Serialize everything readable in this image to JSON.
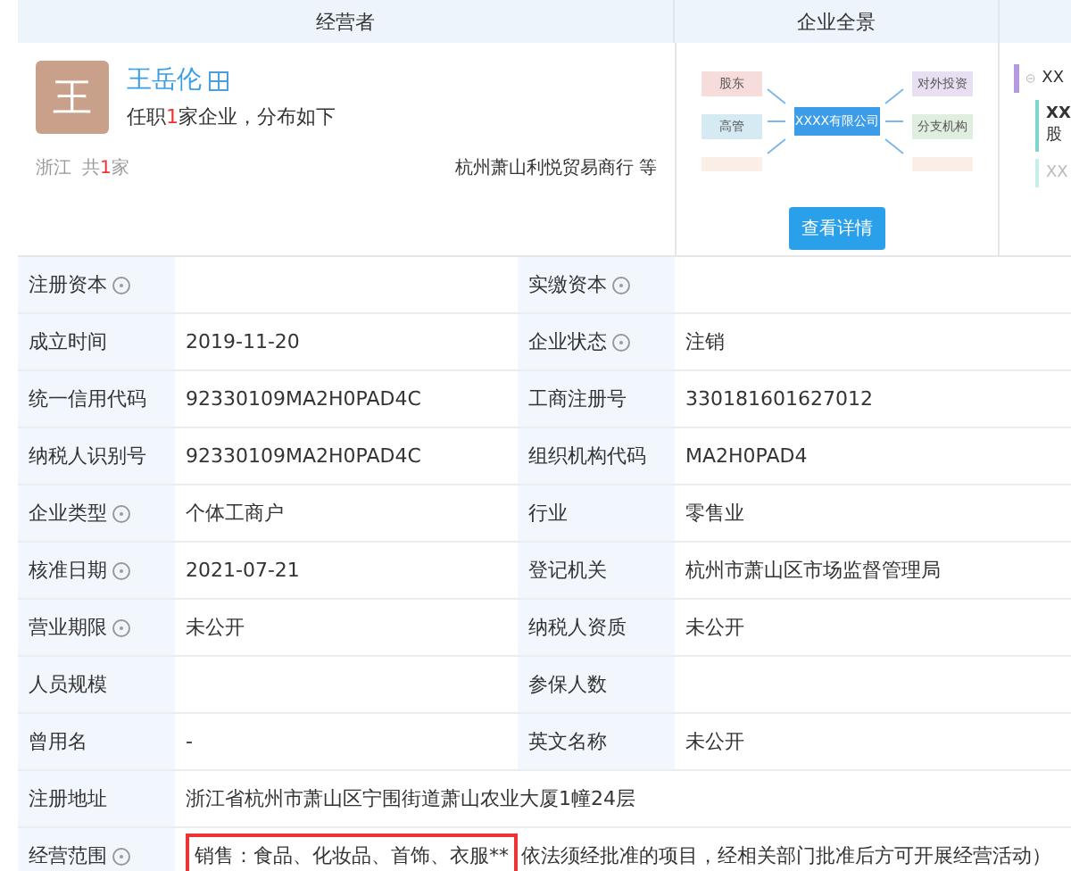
{
  "headers": [
    "经营者",
    "企业全景"
  ],
  "operator": {
    "avatar": "王",
    "name": "王岳伦",
    "summary_prefix": "任职",
    "summary_count": "1",
    "summary_suffix": "家企业，分布如下",
    "region": "浙江",
    "region_prefix": "共",
    "region_count": "1",
    "region_suffix": "家",
    "company": "杭州萧山利悦贸易商行 等"
  },
  "panorama": {
    "left_nodes": [
      "股东",
      "高管"
    ],
    "center": "XXXX有限公司",
    "right_nodes": [
      "对外投资",
      "分支机构"
    ],
    "button": "查看详情"
  },
  "tree": {
    "root": "XX",
    "child_title": "XX",
    "child_sub": "股",
    "faded": "XX"
  },
  "rows": [
    {
      "kind": "pair",
      "cells": [
        {
          "label": "注册资本",
          "help": true
        },
        {
          "label": "实缴资本",
          "help": true
        }
      ]
    },
    {
      "kind": "pair",
      "cells": [
        {
          "label": "成立时间",
          "help": false,
          "value": "2019-11-20"
        },
        {
          "label": "企业状态",
          "help": true,
          "value": "注销"
        }
      ]
    },
    {
      "kind": "pair",
      "cells": [
        {
          "label": "统一信用代码",
          "help": false,
          "value": "92330109MA2H0PAD4C"
        },
        {
          "label": "工商注册号",
          "help": false,
          "value": "330181601627012"
        }
      ]
    },
    {
      "kind": "pair",
      "cells": [
        {
          "label": "纳税人识别号",
          "help": false,
          "value": "92330109MA2H0PAD4C"
        },
        {
          "label": "组织机构代码",
          "help": false,
          "value": "MA2H0PAD4"
        }
      ]
    },
    {
      "kind": "pair",
      "cells": [
        {
          "label": "企业类型",
          "help": true,
          "value": "个体工商户"
        },
        {
          "label": "行业",
          "help": false,
          "value": "零售业"
        }
      ]
    },
    {
      "kind": "pair",
      "cells": [
        {
          "label": "核准日期",
          "help": true,
          "value": "2021-07-21"
        },
        {
          "label": "登记机关",
          "help": false,
          "value": "杭州市萧山区市场监督管理局"
        }
      ]
    },
    {
      "kind": "pair",
      "cells": [
        {
          "label": "营业期限",
          "help": true,
          "value": "未公开"
        },
        {
          "label": "纳税人资质",
          "help": false,
          "value": "未公开"
        }
      ]
    },
    {
      "kind": "pair",
      "cells": [
        {
          "label": "人员规模",
          "help": false
        },
        {
          "label": "参保人数",
          "help": false
        }
      ]
    },
    {
      "kind": "pair",
      "cells": [
        {
          "label": "曾用名",
          "help": false,
          "value": "-"
        },
        {
          "label": "英文名称",
          "help": false,
          "value": "未公开"
        }
      ]
    },
    {
      "kind": "wide",
      "cells": [
        {
          "label": "注册地址",
          "help": false,
          "value": "浙江省杭州市萧山区宁围街道萧山农业大厦1幢24层"
        }
      ]
    },
    {
      "kind": "scope",
      "cells": [
        {
          "label": "经营范围",
          "help": true,
          "highlight": "销售：食品、化妆品、首饰、衣服**",
          "value": "依法须经批准的项目，经相关部门批准后方可开展经营活动）"
        }
      ]
    }
  ]
}
